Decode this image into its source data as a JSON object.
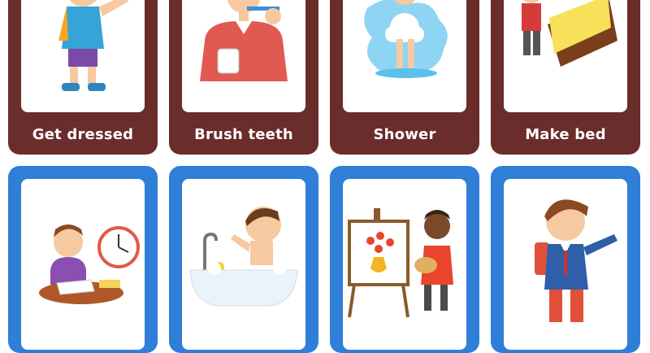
{
  "top_row": {
    "cards": [
      {
        "label": "Get dressed",
        "icon": "boy-dressing-icon"
      },
      {
        "label": "Brush teeth",
        "icon": "man-brushing-teeth-icon"
      },
      {
        "label": "Shower",
        "icon": "girl-showering-icon"
      },
      {
        "label": "Make bed",
        "icon": "boy-making-bed-icon"
      }
    ],
    "card_color": "#6b2c2c"
  },
  "bottom_row": {
    "cards": [
      {
        "icon": "boy-doing-homework-icon"
      },
      {
        "icon": "boy-in-bathtub-icon"
      },
      {
        "icon": "boy-painting-icon"
      },
      {
        "icon": "boy-going-to-school-icon"
      }
    ],
    "card_color": "#2f7ed8"
  }
}
